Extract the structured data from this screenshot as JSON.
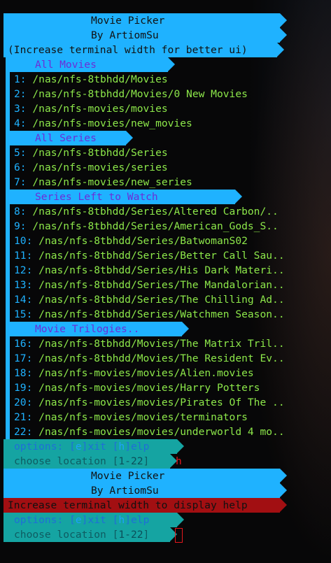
{
  "header": {
    "title": "Movie Picker",
    "author": "By ArtiomSu",
    "hint": "(Increase terminal width for better ui)"
  },
  "sections": {
    "movies": "All Movies",
    "series": "All Series",
    "left_to_watch": "Series Left to Watch",
    "trilogies": "Movie Trilogies.."
  },
  "entries": [
    {
      "num": "1:",
      "path": "/nas/nfs-8tbhdd/Movies"
    },
    {
      "num": "2:",
      "path": "/nas/nfs-8tbhdd/Movies/0 New Movies"
    },
    {
      "num": "3:",
      "path": "/nas/nfs-movies/movies"
    },
    {
      "num": "4:",
      "path": "/nas/nfs-movies/new_movies"
    },
    {
      "num": "5:",
      "path": "/nas/nfs-8tbhdd/Series"
    },
    {
      "num": "6:",
      "path": "/nas/nfs-movies/series"
    },
    {
      "num": "7:",
      "path": "/nas/nfs-movies/new_series"
    },
    {
      "num": "8:",
      "path": "/nas/nfs-8tbhdd/Series/Altered Carbon/.."
    },
    {
      "num": "9:",
      "path": "/nas/nfs-8tbhdd/Series/American_Gods_S.."
    },
    {
      "num": "10:",
      "path": "/nas/nfs-8tbhdd/Series/BatwomanS02"
    },
    {
      "num": "11:",
      "path": "/nas/nfs-8tbhdd/Series/Better Call Sau.."
    },
    {
      "num": "12:",
      "path": "/nas/nfs-8tbhdd/Series/His Dark Materi.."
    },
    {
      "num": "13:",
      "path": "/nas/nfs-8tbhdd/Series/The Mandalorian.."
    },
    {
      "num": "14:",
      "path": "/nas/nfs-8tbhdd/Series/The Chilling Ad.."
    },
    {
      "num": "15:",
      "path": "/nas/nfs-8tbhdd/Series/Watchmen Season.."
    },
    {
      "num": "16:",
      "path": "/nas/nfs-8tbhdd/Movies/The Matrix Tril.."
    },
    {
      "num": "17:",
      "path": "/nas/nfs-8tbhdd/Movies/The Resident Ev.."
    },
    {
      "num": "18:",
      "path": "/nas/nfs-movies/movies/Alien.movies"
    },
    {
      "num": "19:",
      "path": "/nas/nfs-movies/movies/Harry Potters"
    },
    {
      "num": "20:",
      "path": "/nas/nfs-movies/movies/Pirates Of The .."
    },
    {
      "num": "21:",
      "path": "/nas/nfs-movies/movies/terminators"
    },
    {
      "num": "22:",
      "path": "/nas/nfs-movies/movies/underworld 4 mo.."
    }
  ],
  "options": {
    "label": "options: ",
    "exit_open": "[",
    "exit_key": "e",
    "exit_close": "]",
    "exit_word": "xit ",
    "help_open": "[",
    "help_key": "h",
    "help_close": "]",
    "help_word": "elp"
  },
  "choose": {
    "label": "choose location ",
    "range_open": "[",
    "range": "1-22",
    "range_close": "]"
  },
  "first_input": "h",
  "help_error": "Increase terminal width to display help",
  "colors": {
    "bar_blue": "#1fb2ff",
    "bar_teal": "#15a4a2",
    "bar_red": "#a20f12",
    "path_green": "#8de84a",
    "section_purple": "#6b2ed8",
    "input_red": "#e4181d"
  }
}
